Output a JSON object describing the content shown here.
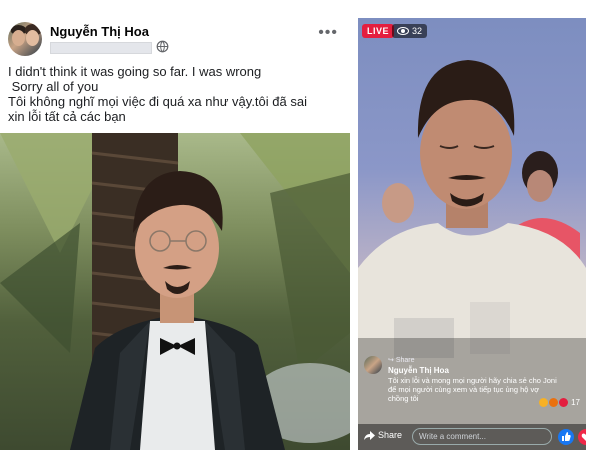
{
  "post": {
    "author": "Nguyễn Thị Hoa",
    "text_lines": [
      "I didn't think it was going so far. I was wrong",
      " Sorry all of you",
      "Tôi không nghĩ mọi việc đi quá xa như vậy.tôi đã sai",
      "xin lỗi tất cả các bạn"
    ],
    "icons": {
      "privacy": "globe-icon",
      "menu": "more-options-icon"
    }
  },
  "live": {
    "badge": "LIVE",
    "viewers": "32",
    "comment": {
      "share_label": "Share",
      "name": "Nguyễn Thị Hoa",
      "text": "Tôi xin lỗi và mong mọi người hãy chia sẻ cho Joni để mọi người cùng xem và tiếp tục ủng hộ vợ chồng tôi",
      "reaction_count": "17"
    },
    "share_label": "Share",
    "comment_placeholder": "Write a comment...",
    "colors": {
      "live": "#e41e3f",
      "like": "#1877f2",
      "heart": "#f02849"
    }
  }
}
